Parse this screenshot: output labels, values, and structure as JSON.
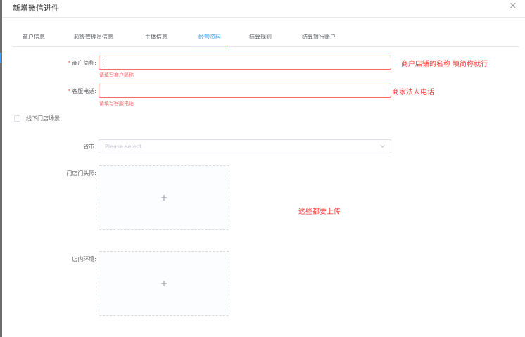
{
  "dialog": {
    "title": "新增微信进件",
    "close_icon": "×"
  },
  "tabs": [
    {
      "label": "商户信息",
      "active": false
    },
    {
      "label": "超级管理员信息",
      "active": false
    },
    {
      "label": "主体信息",
      "active": false
    },
    {
      "label": "经营资料",
      "active": true
    },
    {
      "label": "结算规则",
      "active": false
    },
    {
      "label": "结算银行账户",
      "active": false
    }
  ],
  "form": {
    "required_mark": "*",
    "merchant_short_name": {
      "label": "商户简称:",
      "value": "",
      "error": "请填写商户简称",
      "annotation": "商户店铺的名称 填简称就行"
    },
    "service_phone": {
      "label": "客服电话:",
      "value": "",
      "error": "请填写客服电话",
      "annotation": "商家法人电话"
    },
    "offline_store": {
      "label": "线下门店场景",
      "checked": false
    },
    "province_city": {
      "label": "省市:",
      "placeholder": "Please select"
    },
    "store_front_photo": {
      "label": "门店门头照:",
      "plus": "+"
    },
    "upload_note": "这些都要上传",
    "store_interior": {
      "label": "店内环境:",
      "plus": "+"
    }
  },
  "colors": {
    "accent": "#409eff",
    "error": "#f56c6c",
    "annotation": "#ff3333"
  }
}
